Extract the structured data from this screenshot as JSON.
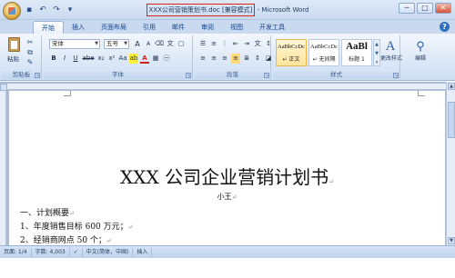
{
  "window": {
    "title_doc": "XXX公司营销策划书.doc [兼容模式]",
    "title_app": " - Microsoft Word"
  },
  "quick_access": {
    "save_icon": "save-icon",
    "undo_icon": "undo-icon",
    "redo_icon": "redo-icon"
  },
  "window_controls": {
    "minimize": "─",
    "maximize": "□",
    "close": "✕"
  },
  "ribbon_tabs": [
    {
      "label": "开始",
      "active": true
    },
    {
      "label": "插入"
    },
    {
      "label": "页面布局"
    },
    {
      "label": "引用"
    },
    {
      "label": "邮件"
    },
    {
      "label": "审阅"
    },
    {
      "label": "视图"
    },
    {
      "label": "开发工具"
    }
  ],
  "ribbon": {
    "clipboard": {
      "paste_label": "粘贴",
      "group_label": "剪贴板"
    },
    "font": {
      "font_name": "宋体",
      "font_size": "五号",
      "group_label": "字体",
      "bold": "B",
      "italic": "I",
      "underline": "U",
      "strike": "abe",
      "subscript": "x₂",
      "superscript": "x²",
      "change_case": "Aa",
      "highlight": "ab",
      "font_color": "A",
      "grow": "A",
      "shrink": "A"
    },
    "paragraph": {
      "group_label": "段落"
    },
    "styles": {
      "group_label": "样式",
      "items": [
        {
          "sample": "AaBbCcDc",
          "name": "↵ 正文",
          "selected": true
        },
        {
          "sample": "AaBbCcDc",
          "name": "↵ 无间隔"
        },
        {
          "sample": "AaBl",
          "name": "标题 1"
        }
      ],
      "change_styles_label": "更改样式"
    },
    "editing": {
      "label": "编辑"
    }
  },
  "document": {
    "title": "XXX 公司企业营销计划书",
    "subtitle": "小王",
    "lines": [
      "一、计划概要",
      "1、年度销售目标 600 万元；",
      "2、经销商网点 50 个；"
    ],
    "para_mark": "↵"
  },
  "statusbar": {
    "page": "页面: 1/4",
    "words": "字数: 4,003",
    "language": "中文(简体，中国)",
    "mode": "插入"
  },
  "colors": {
    "title_highlight": "#d9231c",
    "ribbon_blue": "#c9daf0",
    "accent": "#15428b"
  }
}
